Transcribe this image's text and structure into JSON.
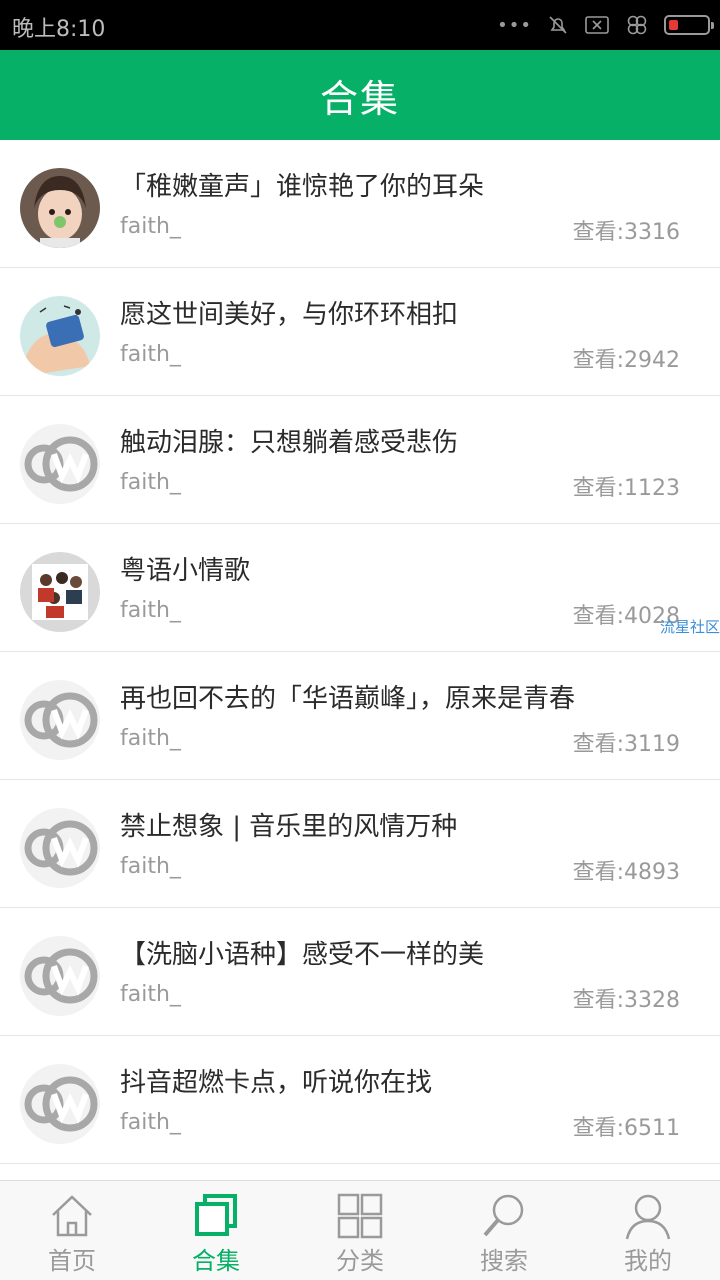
{
  "status_bar": {
    "time": "晚上8:10",
    "dots": "•••"
  },
  "header": {
    "title": "合集"
  },
  "watermark": "流星社区",
  "items": [
    {
      "title": "「稚嫩童声」谁惊艳了你的耳朵",
      "author": "faith_",
      "views": "查看:3316",
      "avatar": "photo-girl"
    },
    {
      "title": "愿这世间美好，与你环环相扣",
      "author": "faith_",
      "views": "查看:2942",
      "avatar": "illustration"
    },
    {
      "title": "触动泪腺：只想躺着感受悲伤",
      "author": "faith_",
      "views": "查看:1123",
      "avatar": "default-logo"
    },
    {
      "title": "粤语小情歌",
      "author": "faith_",
      "views": "查看:4028",
      "avatar": "photo-group"
    },
    {
      "title": "再也回不去的「华语巅峰」，原来是青春",
      "author": "faith_",
      "views": "查看:3119",
      "avatar": "default-logo"
    },
    {
      "title": "禁止想象 | 音乐里的风情万种",
      "author": "faith_",
      "views": "查看:4893",
      "avatar": "default-logo"
    },
    {
      "title": "【洗脑小语种】感受不一样的美",
      "author": "faith_",
      "views": "查看:3328",
      "avatar": "default-logo"
    },
    {
      "title": "抖音超燃卡点，听说你在找",
      "author": "faith_",
      "views": "查看:6511",
      "avatar": "default-logo"
    }
  ],
  "tabs": [
    {
      "label": "首页",
      "icon": "home-icon",
      "active": false
    },
    {
      "label": "合集",
      "icon": "collection-icon",
      "active": true
    },
    {
      "label": "分类",
      "icon": "grid-icon",
      "active": false
    },
    {
      "label": "搜索",
      "icon": "search-icon",
      "active": false
    },
    {
      "label": "我的",
      "icon": "person-icon",
      "active": false
    }
  ],
  "colors": {
    "brand": "#07b067",
    "inactive": "#9a9a9a"
  }
}
